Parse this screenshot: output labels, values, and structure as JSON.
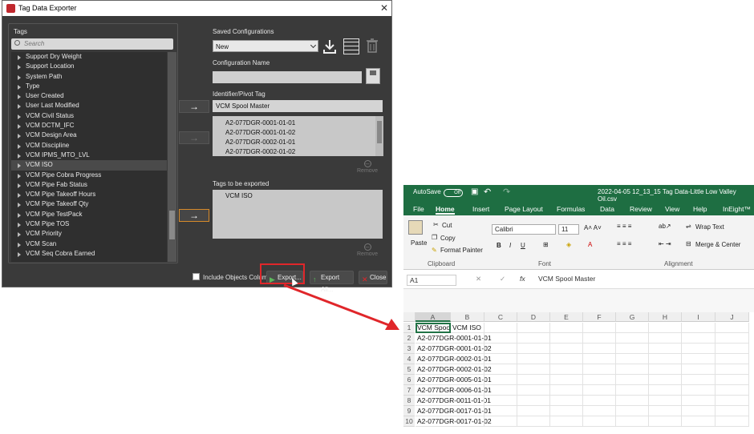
{
  "dialog": {
    "title": "Tag Data Exporter",
    "tags_label": "Tags",
    "search_placeholder": "Search",
    "tags": [
      "Support Dry Weight",
      "Support Location",
      "System Path",
      "Type",
      "User Created",
      "User Last Modified",
      "VCM Civil Status",
      "VCM DCTM_IFC",
      "VCM Design Area",
      "VCM Discipline",
      "VCM IPMS_MTO_LVL",
      "VCM ISO",
      "VCM Pipe Cobra Progress",
      "VCM Pipe Fab Status",
      "VCM Pipe Takeoff Hours",
      "VCM Pipe Takeoff Qty",
      "VCM Pipe TestPack",
      "VCM Pipe TOS",
      "VCM Priority",
      "VCM Scan",
      "VCM Seq Cobra Earned"
    ],
    "selected_tag": "VCM ISO",
    "saved_configs_label": "Saved Configurations",
    "saved_config_value": "New",
    "config_name_label": "Configuration Name",
    "config_name_value": "",
    "identifier_label": "Identifier/Pivot Tag",
    "identifier_value": "VCM Spool Master",
    "identifier_values": [
      "A2-077DGR-0001-01-01",
      "A2-077DGR-0001-01-02",
      "A2-077DGR-0002-01-01",
      "A2-077DGR-0002-01-02"
    ],
    "remove_label": "Remove",
    "tags_export_label": "Tags to be exported",
    "tags_export": [
      "VCM ISO"
    ],
    "include_objects_label": "Include Objects Column",
    "export_label": "Export...",
    "export_all_label": "Export All...",
    "close_label": "Close",
    "arrow": "→",
    "close_x": "✕",
    "accent_color": "#e0262a"
  },
  "excel": {
    "autosave_label": "AutoSave",
    "autosave_state": "Off",
    "file_title": "2022-04-05 12_13_15 Tag Data-Little Low Valley Oil.csv",
    "ribbon_tabs": [
      "File",
      "Home",
      "Insert",
      "Page Layout",
      "Formulas",
      "Data",
      "Review",
      "View",
      "Help",
      "InEight™"
    ],
    "cut": "Cut",
    "copy": "Copy",
    "format_painter": "Format Painter",
    "paste": "Paste",
    "clipboard": "Clipboard",
    "font_name": "Calibri",
    "font_size": "11",
    "font_group": "Font",
    "wrap_text": "Wrap Text",
    "merge_center": "Merge & Center",
    "alignment": "Alignment",
    "name_box": "A1",
    "formula": "VCM Spool Master",
    "fx": "fx",
    "columns": [
      "A",
      "B",
      "C",
      "D",
      "E",
      "F",
      "G",
      "H",
      "I",
      "J"
    ],
    "rows": [
      [
        "VCM Spool Master",
        "VCM ISO"
      ],
      [
        "A2-077DGR-0001-01-01",
        ""
      ],
      [
        "A2-077DGR-0001-01-02",
        ""
      ],
      [
        "A2-077DGR-0002-01-01",
        ""
      ],
      [
        "A2-077DGR-0002-01-02",
        ""
      ],
      [
        "A2-077DGR-0005-01-01",
        ""
      ],
      [
        "A2-077DGR-0006-01-01",
        ""
      ],
      [
        "A2-077DGR-0011-01-01",
        ""
      ],
      [
        "A2-077DGR-0017-01-01",
        ""
      ],
      [
        "A2-077DGR-0017-01-02",
        ""
      ]
    ],
    "brand_color": "#1e6e42"
  }
}
